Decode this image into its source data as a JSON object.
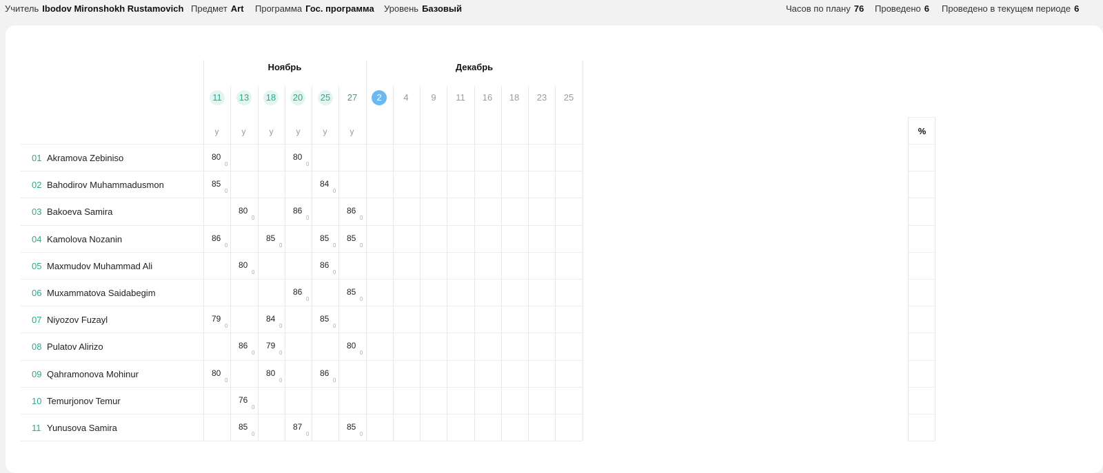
{
  "header": {
    "teacher": {
      "label": "Учитель",
      "value": "Ibodov Mironshokh Rustamovich"
    },
    "subject": {
      "label": "Предмет",
      "value": "Art"
    },
    "program": {
      "label": "Программа",
      "value": "Гос. программа"
    },
    "level": {
      "label": "Уровень",
      "value": "Базовый"
    },
    "hours_plan": {
      "label": "Часов по плану",
      "value": "76"
    },
    "conducted": {
      "label": "Проведено",
      "value": "6"
    },
    "conducted_period": {
      "label": "Проведено в текущем периоде",
      "value": "6"
    }
  },
  "journal": {
    "months": [
      {
        "name": "Ноябрь",
        "days": [
          "11",
          "13",
          "18",
          "20",
          "25",
          "27"
        ]
      },
      {
        "name": "Декабрь",
        "days": [
          "2",
          "4",
          "9",
          "11",
          "16",
          "18",
          "23",
          "25"
        ]
      }
    ],
    "lesson_type": "у",
    "conducted_lessons": 6,
    "current_lesson_index": 6,
    "percent_header": "%",
    "colors": {
      "accent": "#2aa88a",
      "past_bg": "#e3f5f1",
      "current": "#6cb8f0",
      "future": "#9a9a9a"
    },
    "students": [
      {
        "num": "01",
        "name": "Akramova Zebiniso",
        "grades": [
          "80",
          "",
          "",
          "80",
          "",
          ""
        ],
        "subs": [
          "0",
          "",
          "",
          "0",
          "",
          ""
        ]
      },
      {
        "num": "02",
        "name": "Bahodirov Muhammadusmon",
        "grades": [
          "85",
          "",
          "",
          "",
          "84",
          ""
        ],
        "subs": [
          "0",
          "",
          "",
          "",
          "0",
          ""
        ]
      },
      {
        "num": "03",
        "name": "Bakoeva Samira",
        "grades": [
          "",
          "80",
          "",
          "86",
          "",
          "86"
        ],
        "subs": [
          "",
          "0",
          "",
          "0",
          "",
          "0"
        ]
      },
      {
        "num": "04",
        "name": "Kamolova Nozanin",
        "grades": [
          "86",
          "",
          "85",
          "",
          "85",
          "85"
        ],
        "subs": [
          "0",
          "",
          "0",
          "",
          "0",
          "0"
        ]
      },
      {
        "num": "05",
        "name": "Maxmudov Muhammad Ali",
        "grades": [
          "",
          "80",
          "",
          "",
          "86",
          ""
        ],
        "subs": [
          "",
          "0",
          "",
          "",
          "0",
          ""
        ]
      },
      {
        "num": "06",
        "name": "Muxammatova Saidabegim",
        "grades": [
          "",
          "",
          "",
          "86",
          "",
          "85"
        ],
        "subs": [
          "",
          "",
          "",
          "0",
          "",
          "0"
        ]
      },
      {
        "num": "07",
        "name": "Niyozov Fuzayl",
        "grades": [
          "79",
          "",
          "84",
          "",
          "85",
          ""
        ],
        "subs": [
          "0",
          "",
          "0",
          "",
          "0",
          ""
        ]
      },
      {
        "num": "08",
        "name": "Pulatov Alirizo",
        "grades": [
          "",
          "86",
          "79",
          "",
          "",
          "80"
        ],
        "subs": [
          "",
          "0",
          "0",
          "",
          "",
          "0"
        ]
      },
      {
        "num": "09",
        "name": "Qahramonova Mohinur",
        "grades": [
          "80",
          "",
          "80",
          "",
          "86",
          ""
        ],
        "subs": [
          "0",
          "",
          "0",
          "",
          "0",
          ""
        ]
      },
      {
        "num": "10",
        "name": "Temurjonov Temur",
        "grades": [
          "",
          "76",
          "",
          "",
          "",
          ""
        ],
        "subs": [
          "",
          "0",
          "",
          "",
          "",
          ""
        ]
      },
      {
        "num": "11",
        "name": "Yunusova Samira",
        "grades": [
          "",
          "85",
          "",
          "87",
          "",
          "85"
        ],
        "subs": [
          "",
          "0",
          "",
          "0",
          "",
          "0"
        ]
      }
    ]
  }
}
